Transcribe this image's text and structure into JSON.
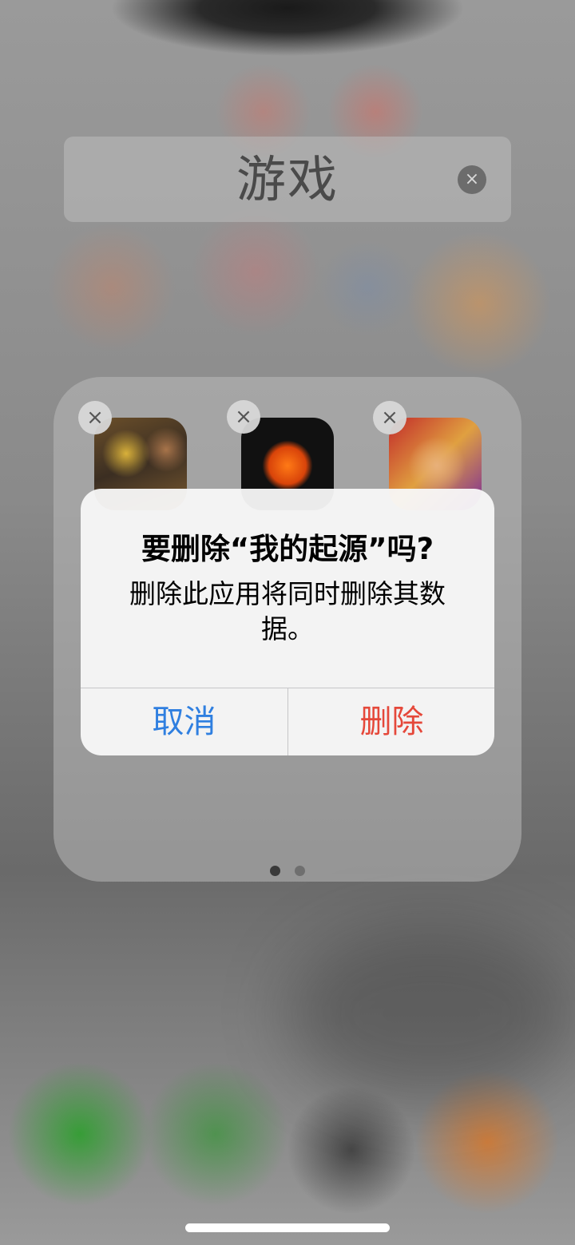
{
  "folder": {
    "title": "游戏",
    "clear_icon": "×",
    "apps": [
      {
        "name": "game-app-1",
        "delete_icon": "×"
      },
      {
        "name": "game-app-2",
        "delete_icon": "×"
      },
      {
        "name": "game-app-3",
        "delete_icon": "×"
      }
    ],
    "page_indicator": {
      "current_page": 1,
      "total_pages": 2
    }
  },
  "alert": {
    "title": "要删除“我的起源”吗?",
    "message": "删除此应用将同时删除其数据。",
    "buttons": {
      "cancel": "取消",
      "delete": "删除"
    },
    "colors": {
      "cancel": "#2f7fe0",
      "delete": "#e5483a"
    }
  }
}
